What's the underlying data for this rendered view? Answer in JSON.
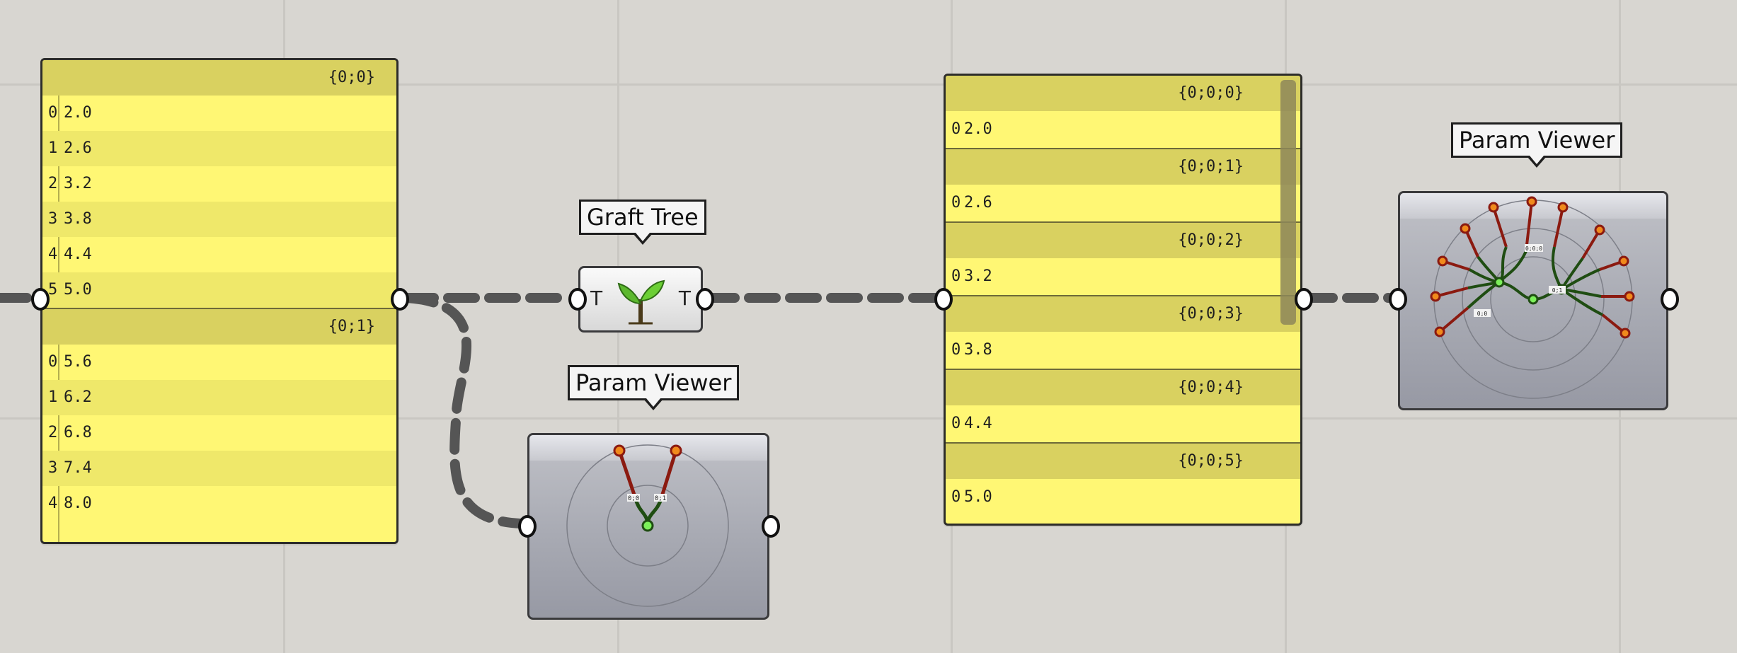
{
  "panel_left": {
    "branches": [
      {
        "path": "{0;0}",
        "items": [
          [
            "0",
            "2.0"
          ],
          [
            "1",
            "2.6"
          ],
          [
            "2",
            "3.2"
          ],
          [
            "3",
            "3.8"
          ],
          [
            "4",
            "4.4"
          ],
          [
            "5",
            "5.0"
          ]
        ]
      },
      {
        "path": "{0;1}",
        "items": [
          [
            "0",
            "5.6"
          ],
          [
            "1",
            "6.2"
          ],
          [
            "2",
            "6.8"
          ],
          [
            "3",
            "7.4"
          ],
          [
            "4",
            "8.0"
          ]
        ]
      }
    ]
  },
  "graft_tree": {
    "label": "Graft Tree",
    "input_port": "T",
    "output_port": "T",
    "icon": "sprout-icon"
  },
  "param_viewer_small": {
    "label": "Param Viewer",
    "node_tags": [
      "0;0",
      "0;1"
    ]
  },
  "panel_right": {
    "branches": [
      {
        "path": "{0;0;0}",
        "items": [
          [
            "0",
            "2.0"
          ]
        ]
      },
      {
        "path": "{0;0;1}",
        "items": [
          [
            "0",
            "2.6"
          ]
        ]
      },
      {
        "path": "{0;0;2}",
        "items": [
          [
            "0",
            "3.2"
          ]
        ]
      },
      {
        "path": "{0;0;3}",
        "items": [
          [
            "0",
            "3.8"
          ]
        ]
      },
      {
        "path": "{0;0;4}",
        "items": [
          [
            "0",
            "4.4"
          ]
        ]
      },
      {
        "path": "{0;0;5}",
        "items": [
          [
            "0",
            "5.0"
          ]
        ]
      }
    ]
  },
  "param_viewer_large": {
    "label": "Param Viewer",
    "node_tags": [
      "0;0;0",
      "0;0",
      "0;1"
    ]
  },
  "colors": {
    "canvas": "#d8d6d1",
    "panel_yellow": "#fff774",
    "panel_header": "#d9d160",
    "wire": "#555555",
    "leaf_node": "#f08a1c",
    "root_node": "#7cf05a",
    "branch_red": "#8b1a10",
    "branch_green": "#1f4d12"
  }
}
